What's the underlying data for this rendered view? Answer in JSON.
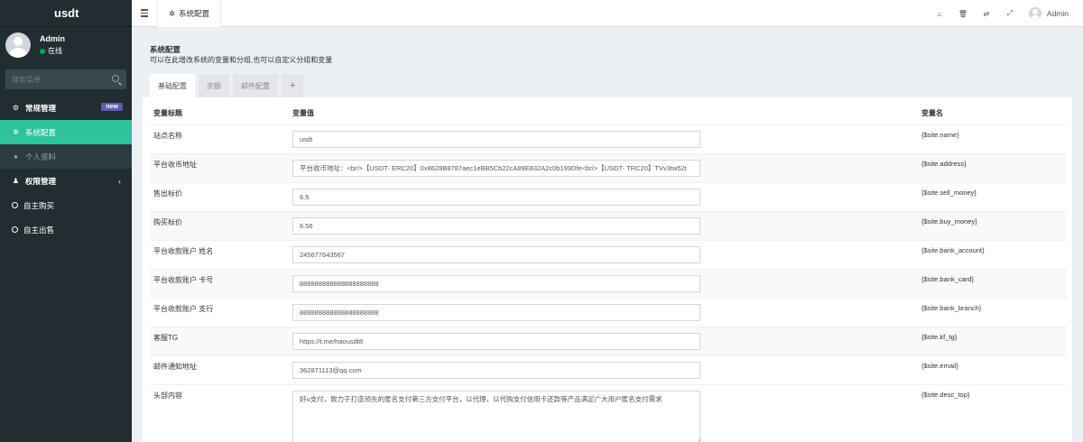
{
  "app": {
    "logo": "usdt"
  },
  "user": {
    "name": "Admin",
    "status": "在线"
  },
  "search": {
    "placeholder": "搜索菜单"
  },
  "menu": {
    "items": [
      {
        "label": "常规管理",
        "badge": "new"
      },
      {
        "label": "系统配置"
      },
      {
        "label": "个人资料"
      },
      {
        "label": "权限管理"
      },
      {
        "label": "自主购买"
      },
      {
        "label": "自主出售"
      }
    ]
  },
  "topbar": {
    "tab_label": "系统配置",
    "user": "Admin"
  },
  "panel": {
    "title": "系统配置",
    "description": "可以在此增改系统的变量和分组,也可以自定义分组和变量",
    "tabs": [
      "基础配置",
      "余额",
      "邮件配置",
      "+"
    ]
  },
  "table": {
    "headers": [
      "变量标题",
      "变量值",
      "变量名"
    ],
    "rows": [
      {
        "title": "站点名称",
        "value": "usdt",
        "name": "{$site.name}"
      },
      {
        "title": "平台收币地址",
        "value": "平台收币地址：<br/>【USDT- ERC20】0x8628B8787aec1eBB5Cb22cA89E832A2c0b199Dfe<br/>【USDT- TRC20】TVv3tw52t",
        "name": "{$site.address}"
      },
      {
        "title": "售出标价",
        "value": "6.5",
        "name": "{$site.sell_money}"
      },
      {
        "title": "购买标价",
        "value": "6.56",
        "name": "{$site.buy_money}"
      },
      {
        "title": "平台收款账户 姓名",
        "value": "245677643567",
        "name": "{$site.bank_account}"
      },
      {
        "title": "平台收款账户 卡号",
        "value": "888888888888888888888",
        "name": "{$site.bank_card}"
      },
      {
        "title": "平台收款账户 支行",
        "value": "888888888888888888888",
        "name": "{$site.bank_branch}"
      },
      {
        "title": "客服TG",
        "value": "https://t.me/haousdt8",
        "name": "{$site.kf_tg}"
      },
      {
        "title": "邮件通知地址",
        "value": "362871113@qq.com",
        "name": "{$site.email}"
      },
      {
        "title": "头部内容",
        "value": "好u支付，致力于打造领先的匿名支付第三方支付平台，以代理，以代购支付信用卡还款等产品满足广大用户匿名支付需求",
        "name": "{$site.desc_top}"
      }
    ]
  },
  "icons": {
    "search": "search-icon",
    "cogs": "cogs-icon",
    "gear": "gear-icon",
    "user": "user-icon",
    "users": "users-icon",
    "circle": "circle-icon",
    "home": "home-icon",
    "trash": "trash-icon",
    "translate": "translate-icon",
    "fullscreen": "fullscreen-icon",
    "menu": "menu-icon"
  },
  "colors": {
    "sidebar": "#222d32",
    "active": "#2fc29c",
    "badge": "#605ca8",
    "online": "#00a65a"
  }
}
